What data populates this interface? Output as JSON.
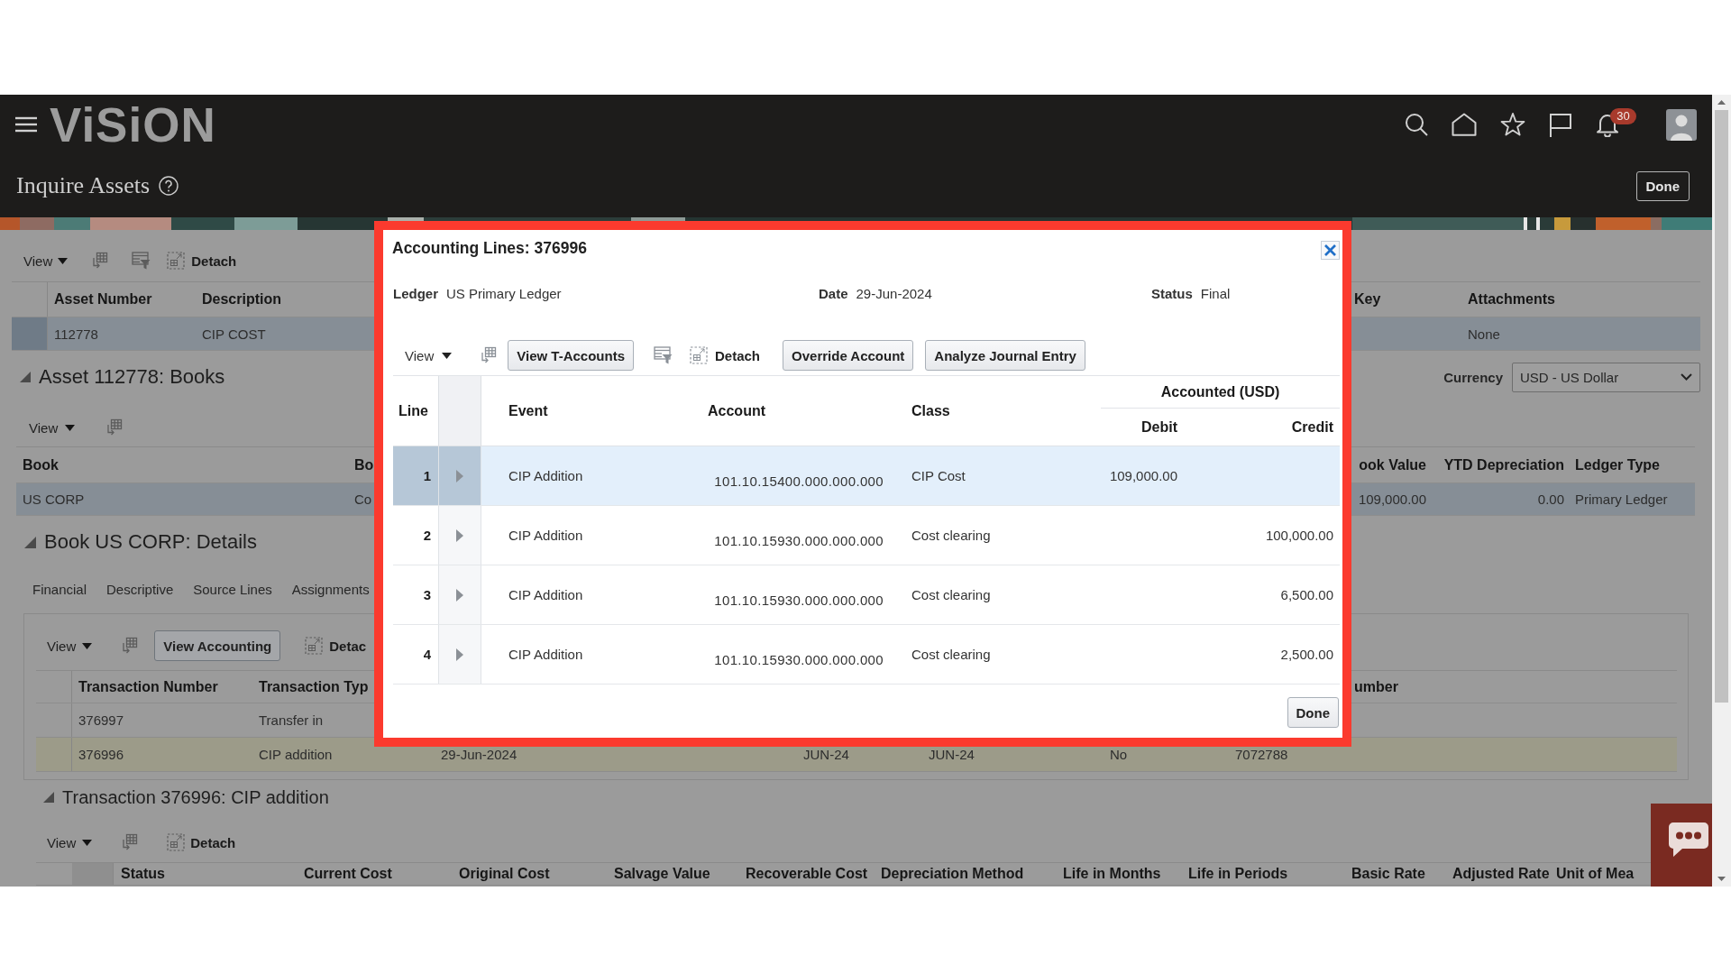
{
  "header": {
    "logo": "ViSiON",
    "page_title": "Inquire Assets",
    "notification_count": "30",
    "done_button": "Done"
  },
  "assets": {
    "toolbar": {
      "view_menu": "View",
      "detach_button": "Detach"
    },
    "columns": {
      "asset_number": "Asset Number",
      "description": "Description",
      "column_3": "Key",
      "attachments": "Attachments"
    },
    "rows": [
      {
        "asset_number": "112778",
        "description": "CIP COST",
        "attachments": "None",
        "selected": true
      }
    ]
  },
  "books_section": {
    "title": "Asset 112778: Books",
    "expanded": true,
    "currency": {
      "label": "Currency",
      "value": "USD - US Dollar"
    },
    "toolbar": {
      "view_menu": "View"
    },
    "columns": {
      "book": "Book",
      "column_2": "Bo",
      "column_3": "ook Value",
      "ytd_depreciation": "YTD Depreciation",
      "ledger_type": "Ledger Type"
    },
    "rows": [
      {
        "book": "US CORP",
        "column_2": "Co",
        "column_3": "109,000.00",
        "ytd_depreciation": "0.00",
        "ledger_type": "Primary Ledger",
        "selected": true
      }
    ]
  },
  "details_section": {
    "title": "Book US CORP: Details",
    "expanded": true,
    "tabs": [
      {
        "label": "Financial",
        "selected": false
      },
      {
        "label": "Descriptive",
        "selected": false
      },
      {
        "label": "Source Lines",
        "selected": false
      },
      {
        "label": "Assignments",
        "selected": false
      }
    ],
    "toolbar": {
      "view_menu": "View",
      "view_accounting_button": "View Accounting",
      "detach_button": "Detac"
    },
    "columns": {
      "transaction_number": "Transaction Number",
      "column_2": "Transaction Typ",
      "column_8": "umber"
    },
    "rows": [
      {
        "transaction_number": "376997",
        "column_2": "Transfer in",
        "selected": false
      },
      {
        "transaction_number": "376996",
        "column_2": "CIP addition",
        "column_3": "29-Jun-2024",
        "column_4": "JUN-24",
        "column_5": "JUN-24",
        "column_6": "No",
        "column_7": "7072788",
        "selected": true
      }
    ]
  },
  "transaction_section": {
    "title": "Transaction 376996: CIP addition",
    "expanded": true,
    "toolbar": {
      "view_menu": "View",
      "detach_button": "Detach"
    },
    "columns": {
      "status": "Status",
      "current_cost": "Current Cost",
      "original_cost": "Original Cost",
      "salvage_value": "Salvage Value",
      "recoverable_cost": "Recoverable Cost",
      "depreciation_method": "Depreciation Method",
      "life_in_months": "Life in Months",
      "life_in_periods": "Life in Periods",
      "basic_rate": "Basic Rate",
      "adjusted_rate": "Adjusted Rate",
      "column_11": "Unit of Mea"
    }
  },
  "dialog": {
    "title": "Accounting Lines: 376996",
    "fields": [
      {
        "label": "Ledger",
        "value": "US Primary Ledger"
      },
      {
        "label": "Date",
        "value": "29-Jun-2024"
      },
      {
        "label": "Status",
        "value": "Final"
      }
    ],
    "toolbar": {
      "view_menu": "View",
      "t_accounts_button": "View T-Accounts",
      "detach_button": "Detach",
      "action_buttons": [
        "Override Account",
        "Analyze Journal Entry"
      ]
    },
    "columns": {
      "line": "Line",
      "event": "Event",
      "account": "Account",
      "class": "Class",
      "accounted_group": "Accounted (USD)",
      "debit": "Debit",
      "credit": "Credit"
    },
    "rows": [
      {
        "line": "1",
        "event": "CIP Addition",
        "account": "101.10.15400.000.000.000",
        "class": "CIP Cost",
        "debit": "109,000.00",
        "expanded": false,
        "selected": true
      },
      {
        "line": "2",
        "event": "CIP Addition",
        "account": "101.10.15930.000.000.000",
        "class": "Cost clearing",
        "credit": "100,000.00",
        "expanded": false,
        "selected": false
      },
      {
        "line": "3",
        "event": "CIP Addition",
        "account": "101.10.15930.000.000.000",
        "class": "Cost clearing",
        "credit": "6,500.00",
        "expanded": false,
        "selected": false
      },
      {
        "line": "4",
        "event": "CIP Addition",
        "account": "101.10.15930.000.000.000",
        "class": "Cost clearing",
        "credit": "2,500.00",
        "expanded": false,
        "selected": false
      }
    ],
    "done_button": "Done"
  }
}
